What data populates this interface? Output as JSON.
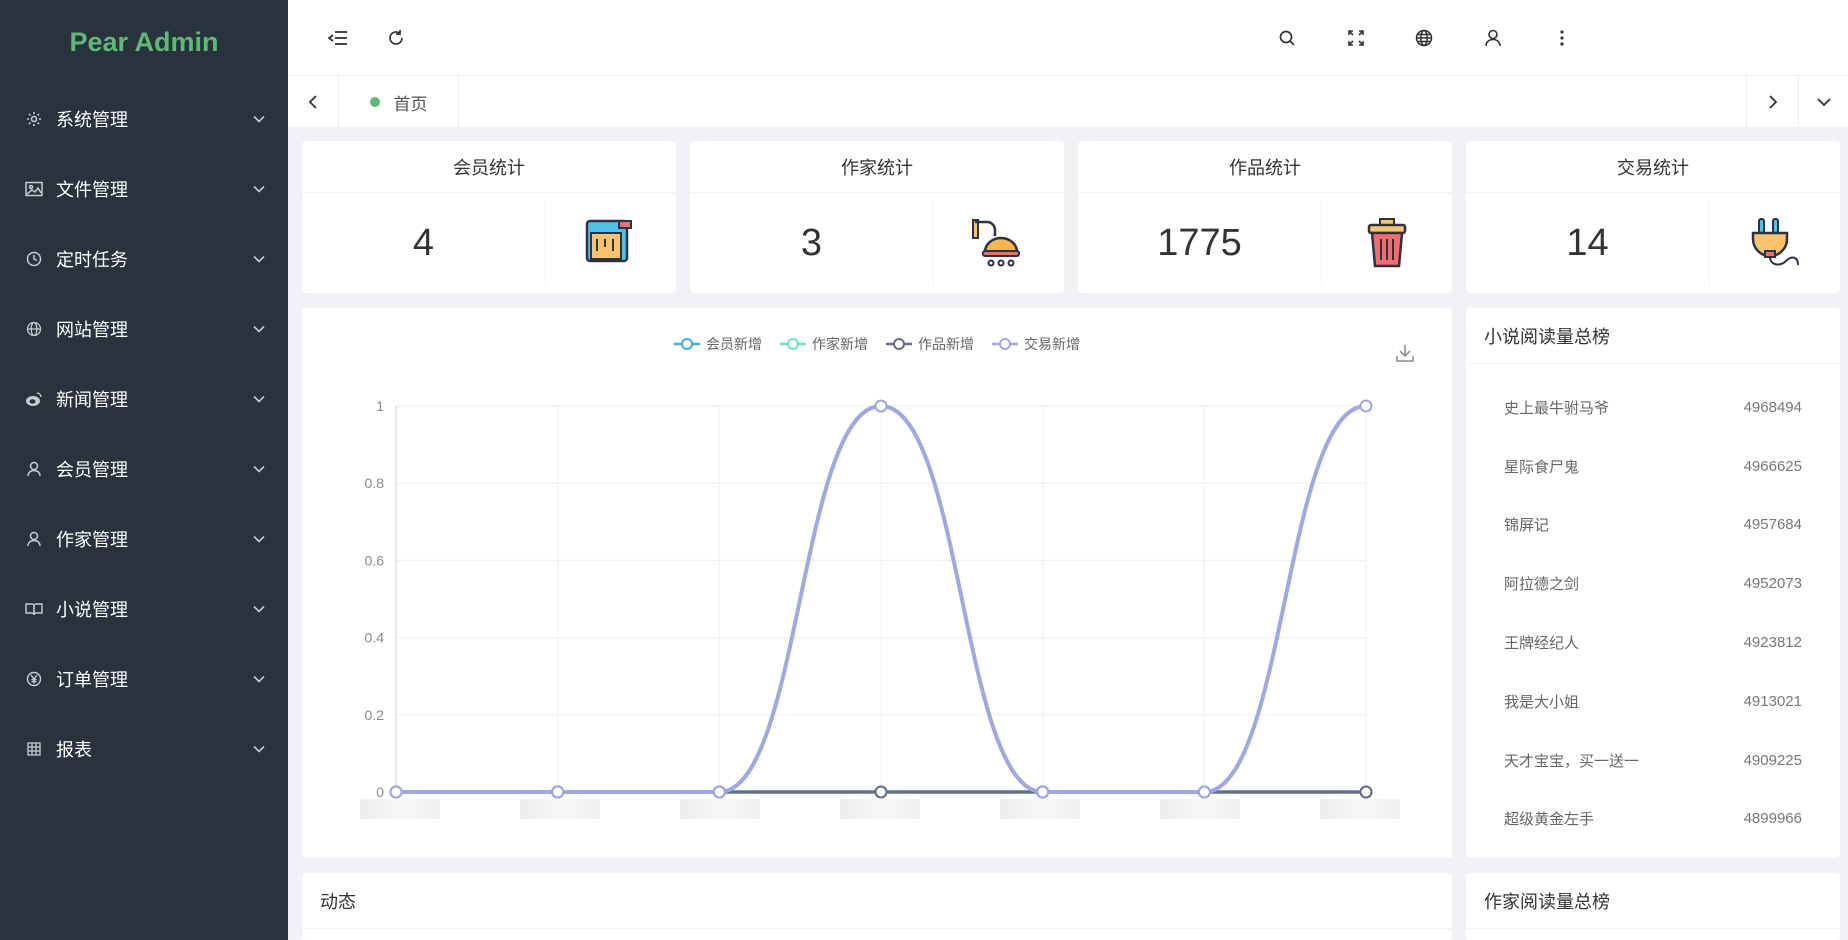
{
  "sidebar": {
    "logo": "Pear Admin",
    "items": [
      {
        "label": "系统管理",
        "icon": "gear-icon"
      },
      {
        "label": "文件管理",
        "icon": "image-icon"
      },
      {
        "label": "定时任务",
        "icon": "clock-icon"
      },
      {
        "label": "网站管理",
        "icon": "globe-icon"
      },
      {
        "label": "新闻管理",
        "icon": "weibo-icon"
      },
      {
        "label": "会员管理",
        "icon": "user-icon"
      },
      {
        "label": "作家管理",
        "icon": "user-icon"
      },
      {
        "label": "小说管理",
        "icon": "book-icon"
      },
      {
        "label": "订单管理",
        "icon": "yen-icon"
      },
      {
        "label": "报表",
        "icon": "table-icon"
      }
    ]
  },
  "header": {
    "left_buttons": [
      "menu-collapse-icon",
      "refresh-icon"
    ],
    "right_buttons": [
      "search-icon",
      "fullscreen-icon",
      "globe-icon",
      "user-icon",
      "more-icon"
    ]
  },
  "tabs": {
    "home": "首页"
  },
  "stats": [
    {
      "title": "会员统计",
      "value": "4",
      "icon": "paint-bucket-icon"
    },
    {
      "title": "作家统计",
      "value": "3",
      "icon": "shower-icon"
    },
    {
      "title": "作品统计",
      "value": "1775",
      "icon": "trash-can-icon"
    },
    {
      "title": "交易统计",
      "value": "14",
      "icon": "plug-icon"
    }
  ],
  "chart_data": {
    "type": "line",
    "smooth": true,
    "series": [
      {
        "name": "会员新增",
        "color": "#3fb1e3",
        "values": [
          0,
          0,
          0,
          0,
          0,
          0,
          0
        ]
      },
      {
        "name": "作家新增",
        "color": "#6be6c1",
        "values": [
          0,
          0,
          0,
          0,
          0,
          0,
          0
        ]
      },
      {
        "name": "作品新增",
        "color": "#626c91",
        "values": [
          0,
          0,
          0,
          0,
          0,
          0,
          0
        ]
      },
      {
        "name": "交易新增",
        "color": "#a0a7e6",
        "values": [
          0,
          0,
          0,
          1,
          0,
          0,
          1
        ]
      }
    ],
    "yticks": [
      "0",
      "0.2",
      "0.4",
      "0.6",
      "0.8",
      "1"
    ],
    "ylim": [
      0,
      1
    ],
    "grid": true,
    "legend": "top-center"
  },
  "ranking": {
    "title": "小说阅读量总榜",
    "rows": [
      {
        "name": "史上最牛驸马爷",
        "count": "4968494"
      },
      {
        "name": "星际食尸鬼",
        "count": "4966625"
      },
      {
        "name": "锦屏记",
        "count": "4957684"
      },
      {
        "name": "阿拉德之剑",
        "count": "4952073"
      },
      {
        "name": "王牌经纪人",
        "count": "4923812"
      },
      {
        "name": "我是大小姐",
        "count": "4913021"
      },
      {
        "name": "天才宝宝，买一送一",
        "count": "4909225"
      },
      {
        "name": "超级黄金左手",
        "count": "4899966"
      }
    ]
  },
  "bottom": {
    "dynamics_title": "动态",
    "author_rank_title": "作家阅读量总榜"
  }
}
